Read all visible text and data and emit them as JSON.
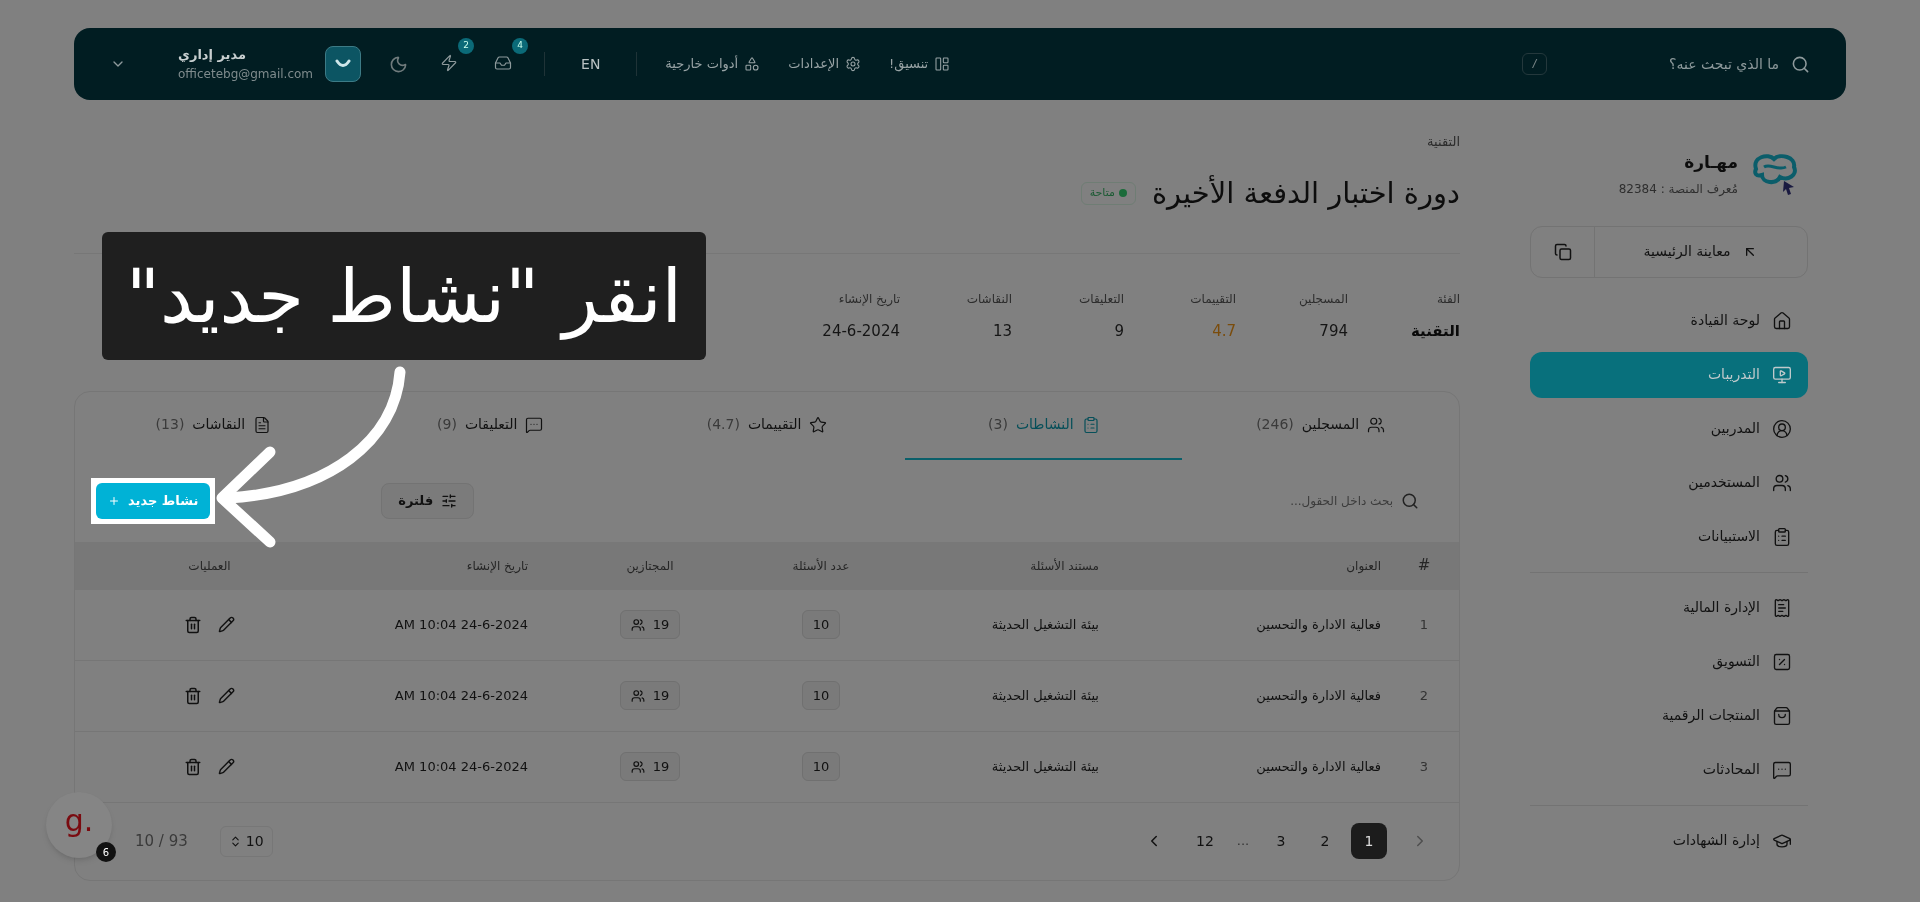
{
  "header": {
    "search": {
      "placeholder": "ما الذي تبحث عنه؟",
      "shortcut": "/"
    },
    "actions": [
      {
        "label": "تنسيق!",
        "kind": "layout"
      },
      {
        "label": "الإعدادات",
        "kind": "settings"
      },
      {
        "label": "أدوات خارجية",
        "kind": "tools"
      }
    ],
    "language": "EN",
    "badges": [
      {
        "kind": "inbox",
        "count": "4"
      },
      {
        "kind": "bolt",
        "count": "2"
      }
    ],
    "user": {
      "name": "مدير إداري",
      "email": "officetebg@gmail.com"
    }
  },
  "sidebar": {
    "brand": "مهـارة",
    "platform_id": "مُعرف المنصة : 82384",
    "preview": "معاينة الرئيسية",
    "groups": [
      [
        {
          "label": "لوحة القيادة",
          "selected": false
        },
        {
          "label": "التدريبات",
          "selected": true
        },
        {
          "label": "المدربين",
          "selected": false
        },
        {
          "label": "المستخدمين",
          "selected": false
        },
        {
          "label": "الاستبيانات",
          "selected": false
        }
      ],
      [
        {
          "label": "الإدارة المالية",
          "selected": false
        },
        {
          "label": "التسويق",
          "selected": false
        },
        {
          "label": "المنتجات الرقمية",
          "selected": false
        },
        {
          "label": "المحادثات",
          "selected": false
        }
      ],
      [
        {
          "label": "إدارة الشهادات",
          "selected": false
        }
      ]
    ]
  },
  "page": {
    "breadcrumb": "التقنية",
    "title": "دورة اختبار الدفعة الأخيرة",
    "status": "متاحة",
    "stats": [
      {
        "label": "الفئة",
        "value": "التقنية",
        "kind": "bold"
      },
      {
        "label": "المسجلين",
        "value": "794",
        "kind": "plain"
      },
      {
        "label": "التقييمات",
        "value": "4.7",
        "kind": "rating"
      },
      {
        "label": "التعليقات",
        "value": "9",
        "kind": "plain"
      },
      {
        "label": "النقاشات",
        "value": "13",
        "kind": "plain"
      },
      {
        "label": "تاريخ الإنشاء",
        "value": "24-6-2024",
        "kind": "plain"
      }
    ]
  },
  "tabs": [
    {
      "label": "المسجلين",
      "count": "(246)",
      "selected": false
    },
    {
      "label": "النشاطات",
      "count": "(3)",
      "selected": true
    },
    {
      "label": "التقييمات",
      "count": "(4.7)",
      "selected": false
    },
    {
      "label": "التعليقات",
      "count": "(9)",
      "selected": false
    },
    {
      "label": "النقاشات",
      "count": "(13)",
      "selected": false
    }
  ],
  "toolbar": {
    "search": {
      "placeholder": "بحث داخل الحقول..."
    },
    "filter": "فلترة",
    "new_button": "نشاط جديد"
  },
  "table": {
    "columns": [
      "#",
      "العنوان",
      "مستند الأسئلة",
      "عدد الأسئلة",
      "المجتازين",
      "تاريخ الإنشاء",
      "العمليات"
    ],
    "rows": [
      {
        "index": "1",
        "title": "فعالية الادارة والتحسين",
        "document": "بيئة التشغيل الحديثة",
        "questions": "10",
        "passed": "19",
        "created": "24-6-2024 10:04 AM"
      },
      {
        "index": "2",
        "title": "فعالية الادارة والتحسين",
        "document": "بيئة التشغيل الحديثة",
        "questions": "10",
        "passed": "19",
        "created": "24-6-2024 10:04 AM"
      },
      {
        "index": "3",
        "title": "فعالية الادارة والتحسين",
        "document": "بيئة التشغيل الحديثة",
        "questions": "10",
        "passed": "19",
        "created": "24-6-2024 10:04 AM"
      }
    ]
  },
  "pagination": {
    "pages": [
      {
        "label": "1",
        "kind": "page",
        "selected": true
      },
      {
        "label": "2",
        "kind": "page",
        "selected": false
      },
      {
        "label": "3",
        "kind": "page",
        "selected": false
      },
      {
        "label": "...",
        "kind": "ellipsis"
      },
      {
        "label": "12",
        "kind": "page",
        "selected": false
      }
    ],
    "range": "10 / 93",
    "page_size": "10"
  },
  "tutorial": {
    "caption": "انقر \"نشاط جديد\""
  },
  "help_widget": {
    "logo": "g.",
    "count": "6"
  }
}
